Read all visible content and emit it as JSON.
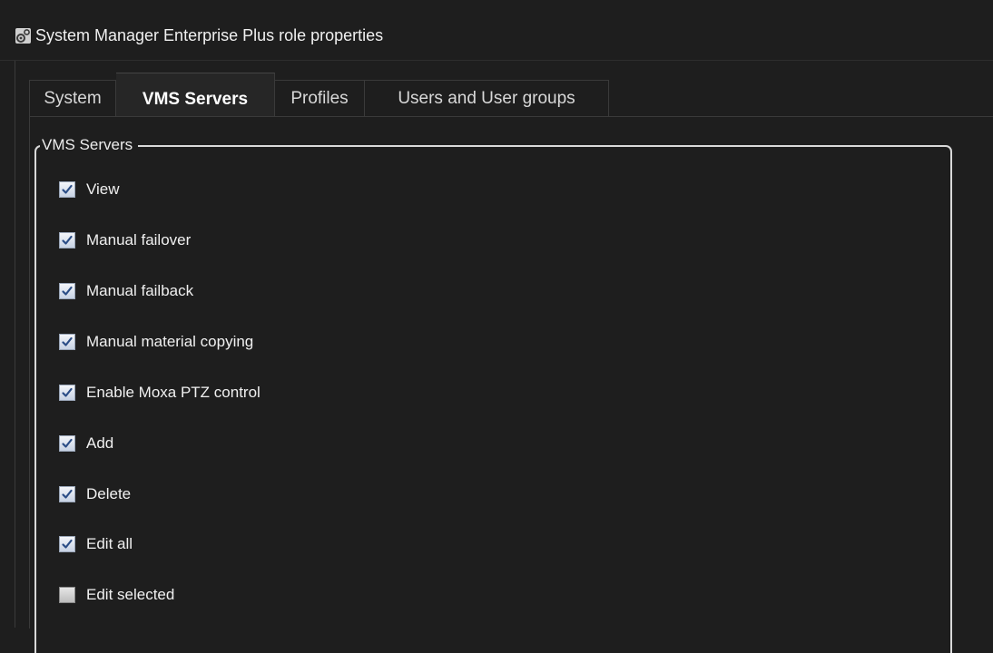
{
  "window": {
    "title": "System Manager Enterprise Plus role properties",
    "icon": "gear-icon"
  },
  "tabs": [
    {
      "label": "System",
      "active": false
    },
    {
      "label": "VMS Servers",
      "active": true
    },
    {
      "label": "Profiles",
      "active": false
    },
    {
      "label": "Users and User groups",
      "active": false
    }
  ],
  "group": {
    "legend": "VMS Servers",
    "items": [
      {
        "label": "View",
        "checked": true
      },
      {
        "label": "Manual failover",
        "checked": true
      },
      {
        "label": "Manual failback",
        "checked": true
      },
      {
        "label": "Manual material copying",
        "checked": true
      },
      {
        "label": "Enable Moxa PTZ control",
        "checked": true
      },
      {
        "label": "Add",
        "checked": true
      },
      {
        "label": "Delete",
        "checked": true
      },
      {
        "label": "Edit all",
        "checked": true
      },
      {
        "label": "Edit selected",
        "checked": false
      }
    ]
  },
  "colors": {
    "background": "#1e1e1e",
    "text": "#f0f0f0",
    "checkmark": "#2b4d86"
  }
}
